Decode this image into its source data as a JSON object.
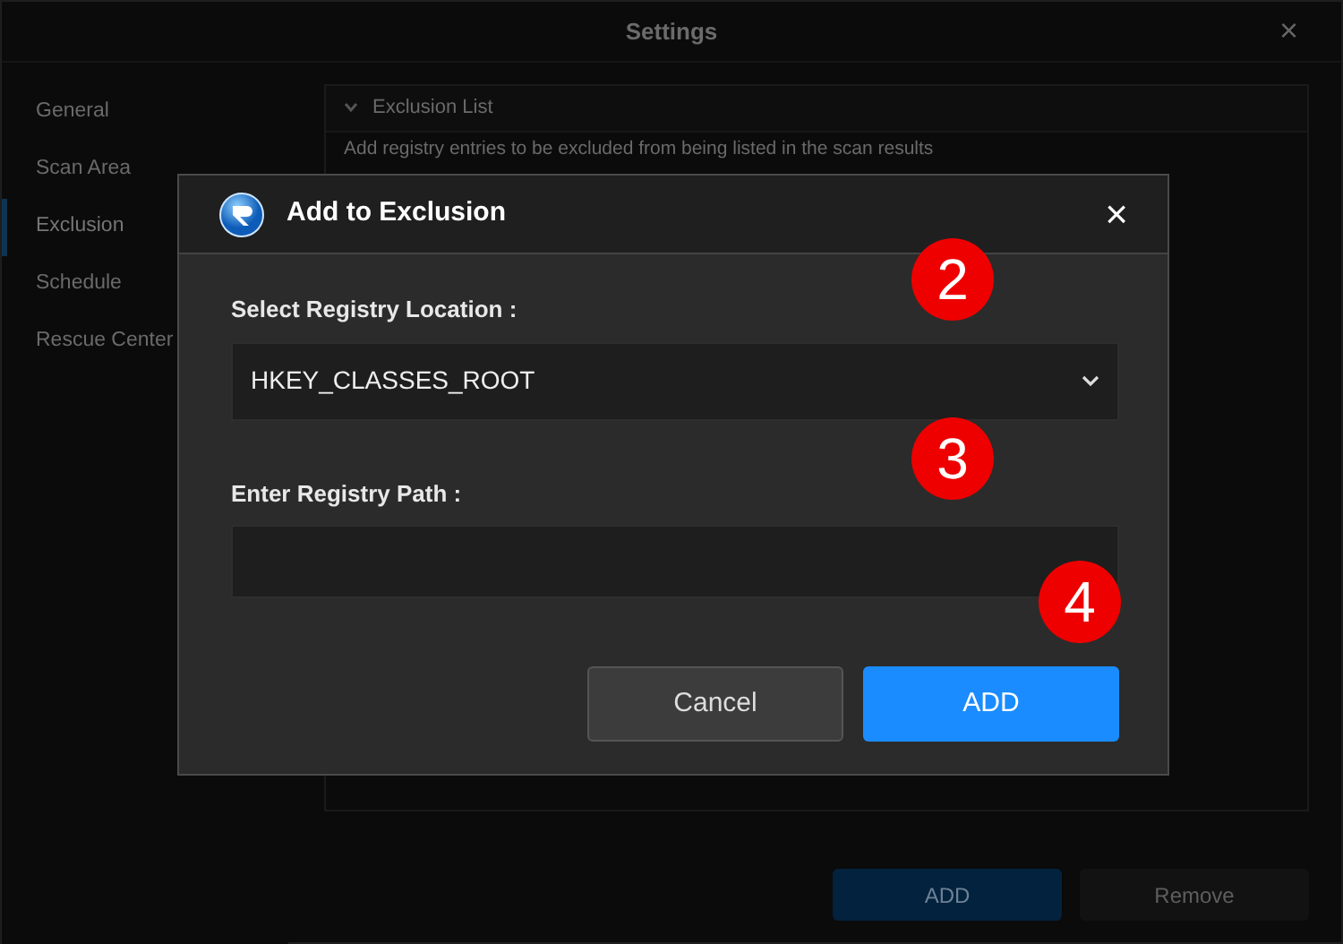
{
  "window": {
    "title": "Settings",
    "close": "×"
  },
  "sidebar": {
    "items": [
      {
        "label": "General",
        "selected": false
      },
      {
        "label": "Scan Area",
        "selected": false
      },
      {
        "label": "Exclusion",
        "selected": true
      },
      {
        "label": "Schedule",
        "selected": false
      },
      {
        "label": "Rescue Center",
        "selected": false
      }
    ]
  },
  "panel": {
    "section": {
      "title": "Exclusion List",
      "expanded": true,
      "description": "Add registry entries to be excluded from being listed in the scan results"
    },
    "buttons": [
      {
        "label": "ADD",
        "kind": "primary"
      },
      {
        "label": "Remove",
        "kind": "secondary"
      }
    ]
  },
  "dialog": {
    "title": "Add to Exclusion",
    "close": "×",
    "location_label": "Select Registry Location :",
    "location_value": "HKEY_CLASSES_ROOT",
    "path_label": "Enter Registry Path :",
    "buttons": [
      {
        "label": "Cancel",
        "kind": "secondary"
      },
      {
        "label": "ADD",
        "kind": "primary"
      }
    ]
  },
  "annotations": [
    {
      "label": "2"
    },
    {
      "label": "3"
    },
    {
      "label": "4"
    }
  ]
}
